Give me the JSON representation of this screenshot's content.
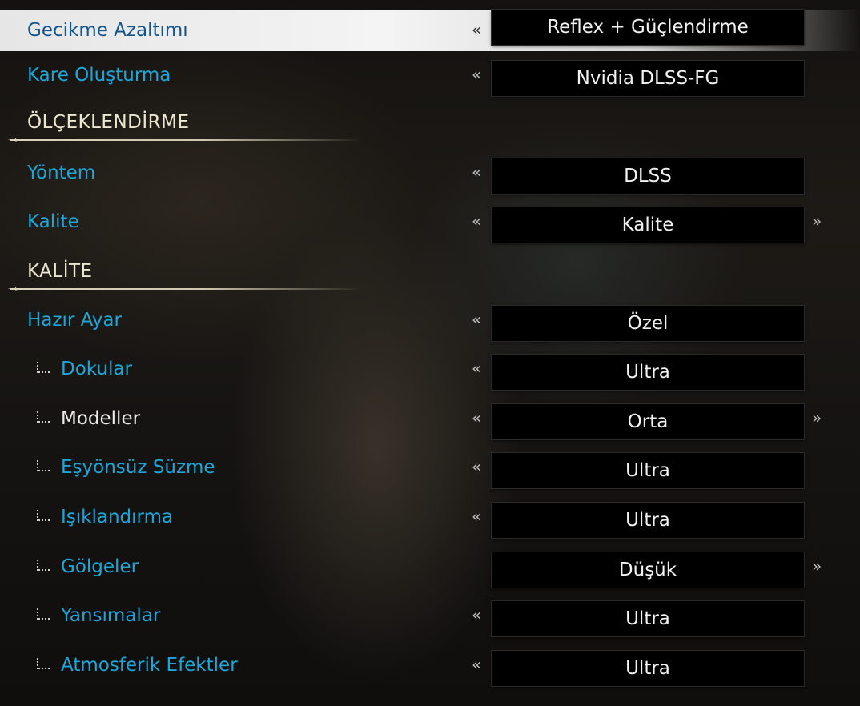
{
  "arrows": {
    "left": "«",
    "right": "»",
    "cap": "⤙"
  },
  "rows": {
    "latency": {
      "label": "Gecikme Azaltımı",
      "value": "Reflex + Güçlendirme"
    },
    "frame_gen": {
      "label": "Kare Oluşturma",
      "value": "Nvidia DLSS-FG"
    },
    "method": {
      "label": "Yöntem",
      "value": "DLSS"
    },
    "quality": {
      "label": "Kalite",
      "value": "Kalite"
    },
    "preset": {
      "label": "Hazır Ayar",
      "value": "Özel"
    },
    "textures": {
      "label": "Dokular",
      "value": "Ultra"
    },
    "models": {
      "label": "Modeller",
      "value": "Orta"
    },
    "aniso": {
      "label": "Eşyönsüz Süzme",
      "value": "Ultra"
    },
    "lighting": {
      "label": "Işıklandırma",
      "value": "Ultra"
    },
    "shadows": {
      "label": "Gölgeler",
      "value": "Düşük"
    },
    "reflections": {
      "label": "Yansımalar",
      "value": "Ultra"
    },
    "atmospheric": {
      "label": "Atmosferik Efektler",
      "value": "Ultra"
    }
  },
  "sections": {
    "upscaling": "ÖLÇEKLENDİRME",
    "quality": "KALİTE"
  }
}
